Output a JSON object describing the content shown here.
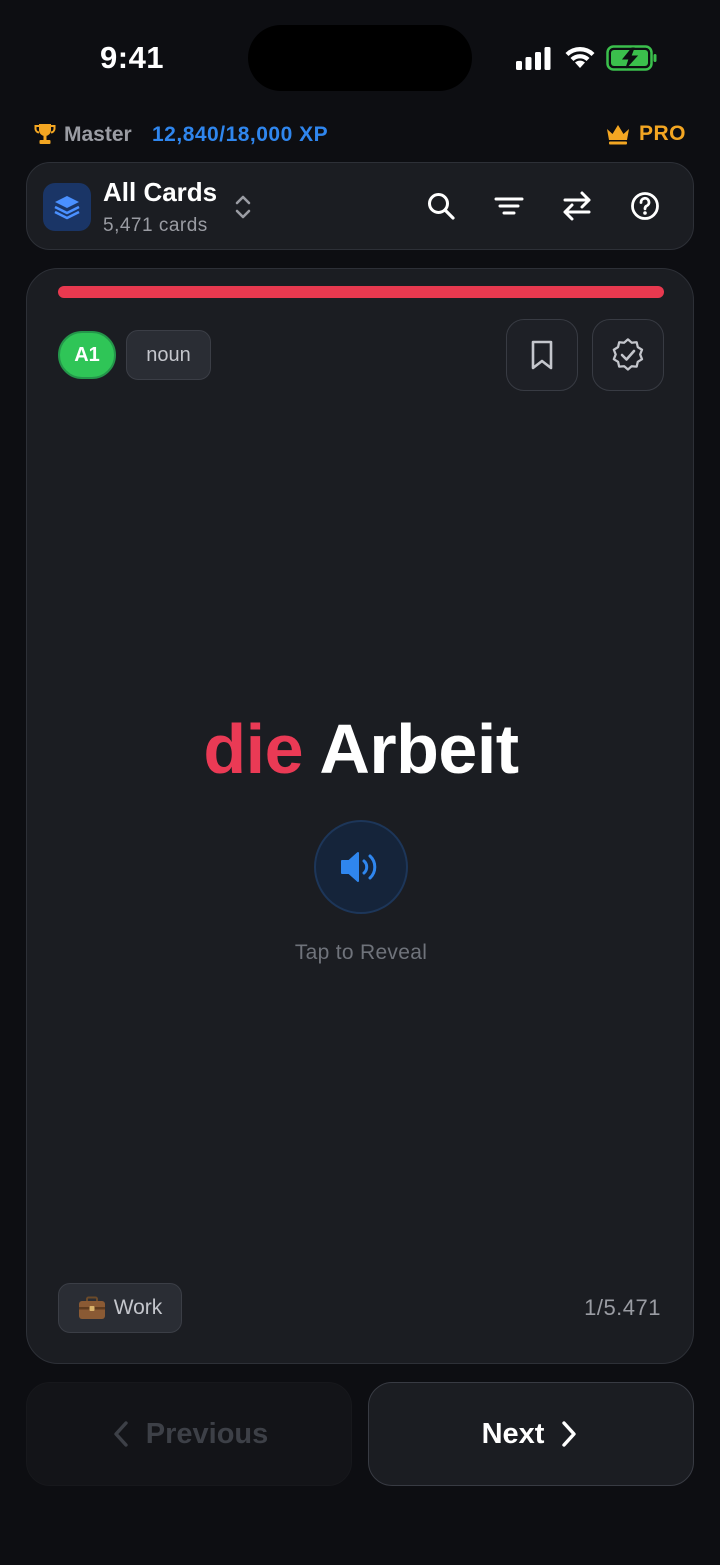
{
  "status_bar": {
    "time": "9:41"
  },
  "level": {
    "rank": "Master",
    "xp": "12,840/18,000 XP",
    "pro_label": "PRO"
  },
  "deck": {
    "title": "All Cards",
    "count": "5,471 cards"
  },
  "card": {
    "cefr_level": "A1",
    "part_of_speech": "noun",
    "article": "die",
    "word": "Arbeit",
    "reveal_hint": "Tap to Reveal",
    "topic": "Work",
    "topic_icon": "briefcase-icon",
    "position": "1/5.471",
    "progress_fraction": 1.0
  },
  "navigation": {
    "previous_label": "Previous",
    "next_label": "Next"
  },
  "colors": {
    "background": "#0d0e12",
    "accent_blue": "#2f86ee",
    "article_red": "#ea3a55",
    "level_green": "#2fc557",
    "pro_gold": "#f3a622"
  }
}
